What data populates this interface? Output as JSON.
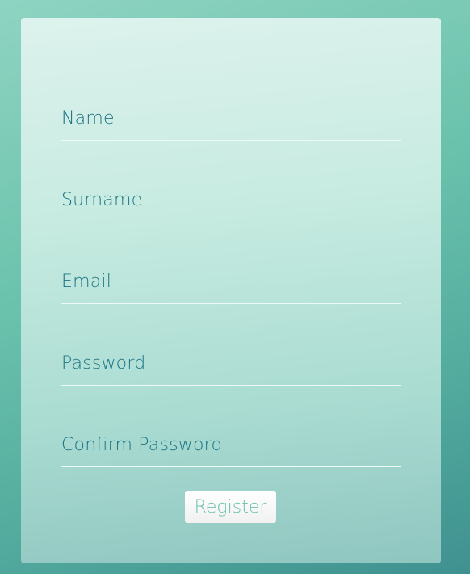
{
  "form": {
    "fields": [
      {
        "label": "Name",
        "value": ""
      },
      {
        "label": "Surname",
        "value": ""
      },
      {
        "label": "Email",
        "value": ""
      },
      {
        "label": "Password",
        "value": ""
      },
      {
        "label": "Confirm Password",
        "value": ""
      }
    ],
    "submit_label": "Register"
  },
  "colors": {
    "label": "#1d7485",
    "button_text": "#6cc0ad",
    "background": "#6cc3ad"
  }
}
